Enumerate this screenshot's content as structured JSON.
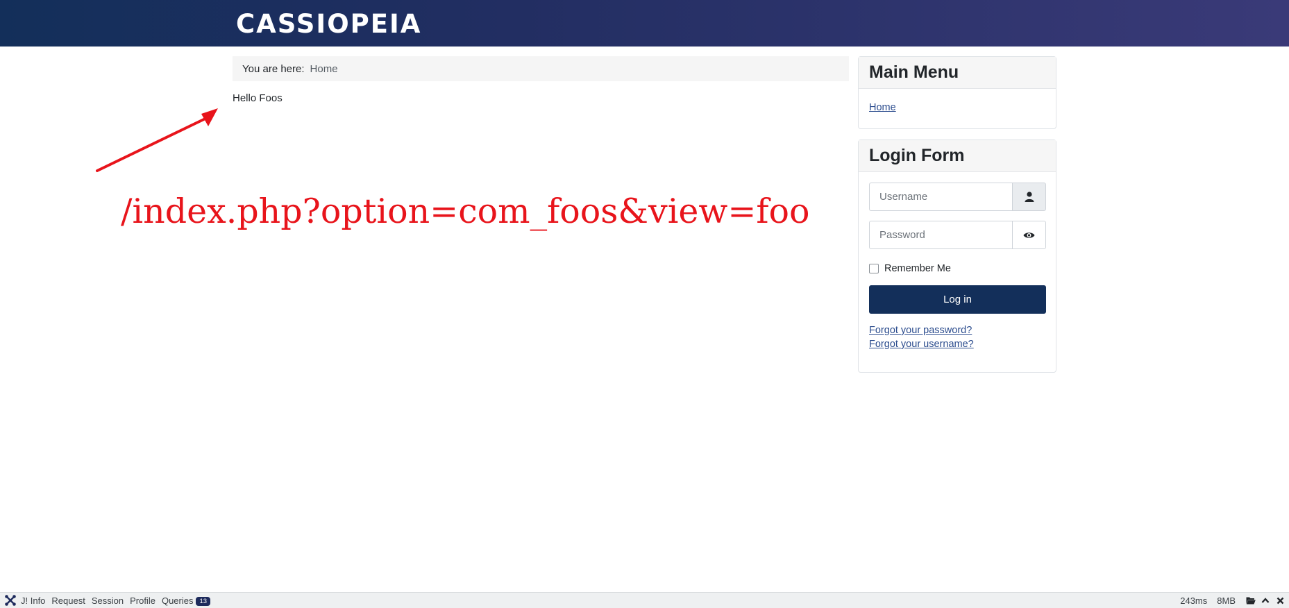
{
  "header": {
    "brand": "CASSIOPEIA",
    "gradient_start": "#132f5a",
    "gradient_end": "#3a3a78"
  },
  "breadcrumb": {
    "prefix": "You are here:",
    "items": [
      "Home"
    ]
  },
  "content": {
    "text": "Hello Foos"
  },
  "annotation": {
    "url": "/index.php?option=com_foos&view=foo",
    "color": "#e8141b"
  },
  "main_menu": {
    "title": "Main Menu",
    "items": [
      "Home"
    ]
  },
  "login_form": {
    "title": "Login Form",
    "username_placeholder": "Username",
    "password_placeholder": "Password",
    "remember_label": "Remember Me",
    "submit_label": "Log in",
    "forgot_password": "Forgot your password?",
    "forgot_username": "Forgot your username?",
    "button_color": "#132f5a"
  },
  "debugbar": {
    "items": [
      "J! Info",
      "Request",
      "Session",
      "Profile",
      "Queries"
    ],
    "queries_count": "13",
    "time": "243ms",
    "memory": "8MB"
  }
}
